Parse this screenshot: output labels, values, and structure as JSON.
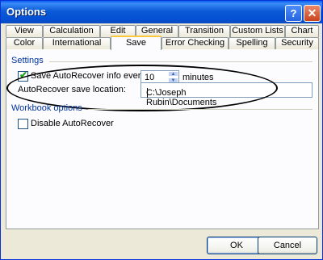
{
  "window": {
    "title": "Options"
  },
  "titlebar": {
    "help_glyph": "?",
    "close_glyph": "✕"
  },
  "tabs": {
    "back_row": [
      "View",
      "Calculation",
      "Edit",
      "General",
      "Transition",
      "Custom Lists",
      "Chart"
    ],
    "front_row": [
      "Color",
      "International",
      "Save",
      "Error Checking",
      "Spelling",
      "Security"
    ],
    "active": "Save"
  },
  "settings": {
    "section_label": "Settings",
    "autorecover_checked": true,
    "autorecover_label": "Save AutoRecover info every:",
    "interval_value": "10",
    "interval_unit": "minutes",
    "location_label": "AutoRecover save location:",
    "location_value": "C:\\Joseph Rubin\\Documents"
  },
  "workbook_options": {
    "section_label": "Workbook options",
    "disable_checked": false,
    "disable_label": "Disable AutoRecover"
  },
  "buttons": {
    "ok": "OK",
    "cancel": "Cancel"
  },
  "colors": {
    "titlebar": "#0550d4",
    "section_label": "#003399",
    "active_tab_accent": "#ffc83c"
  }
}
